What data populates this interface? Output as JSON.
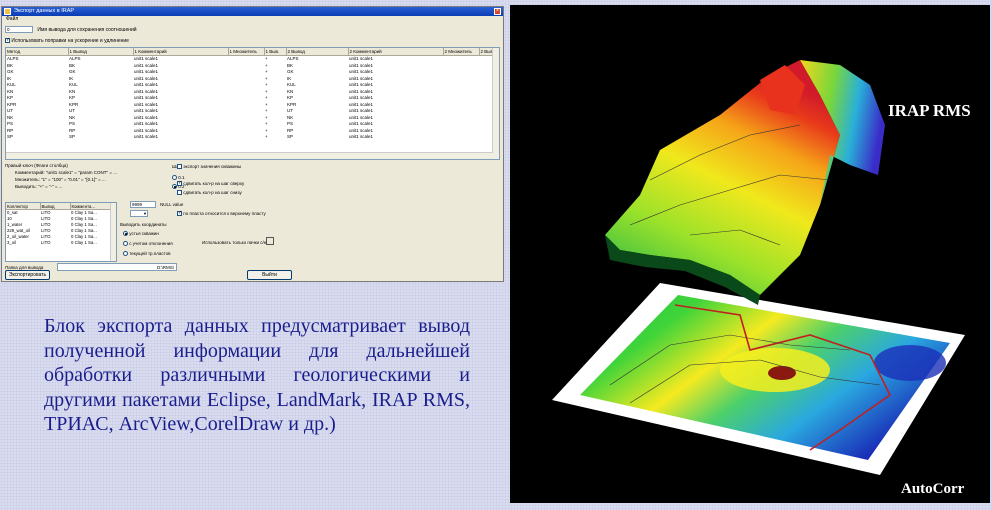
{
  "dialog": {
    "title": "Экспорт данных в IRAP",
    "menu": "Файл",
    "file_value": "0",
    "file_hint": "Имя вывода для сохранения соотношений",
    "use_corrections": "Использовать поправки на ускорение и удлинение",
    "grid": {
      "headers": [
        "Метод",
        "1 Вывод",
        "1 Комментарий",
        "1 Множитель",
        "1 Выв.",
        "2 Вывод",
        "2 Комментарий",
        "2 Множитель",
        "2 Выв."
      ],
      "rows": [
        [
          "ALPS",
          "ALPS",
          "unit1 scale1",
          "",
          "+",
          "ALPS",
          "unit1 scale1",
          "",
          ""
        ],
        [
          "BK",
          "BK",
          "unit1 scale1",
          "",
          "+",
          "BK",
          "unit1 scale1",
          "",
          ""
        ],
        [
          "GK",
          "GK",
          "unit1 scale1",
          "",
          "+",
          "GK",
          "unit1 scale1",
          "",
          ""
        ],
        [
          "IK",
          "IK",
          "unit1 scale1",
          "",
          "+",
          "IK",
          "unit1 scale1",
          "",
          ""
        ],
        [
          "KUL",
          "KUL",
          "unit1 scale1",
          "",
          "+",
          "KUL",
          "unit1 scale1",
          "",
          ""
        ],
        [
          "KN",
          "KN",
          "unit1 scale1",
          "",
          "+",
          "KN",
          "unit1 scale1",
          "",
          ""
        ],
        [
          "KP",
          "KP",
          "unit1 scale1",
          "",
          "+",
          "KP",
          "unit1 scale1",
          "",
          ""
        ],
        [
          "KPR",
          "KPR",
          "unit1 scale1",
          "",
          "+",
          "KPR",
          "unit1 scale1",
          "",
          ""
        ],
        [
          "UT",
          "UT",
          "unit1 scale1",
          "",
          "+",
          "UT",
          "unit1 scale1",
          "",
          ""
        ],
        [
          "NK",
          "NK",
          "unit1 scale1",
          "",
          "+",
          "NK",
          "unit1 scale1",
          "",
          ""
        ],
        [
          "PS",
          "PS",
          "unit1 scale1",
          "",
          "+",
          "PS",
          "unit1 scale1",
          "",
          ""
        ],
        [
          "RP",
          "RP",
          "unit1 scale1",
          "",
          "+",
          "RP",
          "unit1 scale1",
          "",
          ""
        ],
        [
          "SP",
          "SP",
          "unit1 scale1",
          "",
          "+",
          "SP",
          "unit1 scale1",
          "",
          ""
        ]
      ]
    },
    "right_key": "Правый ключ (Флаги столбца)",
    "comment_line": "Комментарий: \"unit1 scale1\" = \"param CONT\" = ...",
    "multiplier_line": "Множитель: \"1\" = \"100\" = \"0.01\" = \"[0.1]\" = ...",
    "output_line": "Выводить: \"+\" = \"-\" = ...",
    "collectors": {
      "headers": [
        "Коллектор",
        "Вывод",
        "Коммента..."
      ],
      "rows": [
        [
          "0_sat",
          "LITO",
          "0 Clay 1 Sa..."
        ],
        [
          "10",
          "LITO",
          "0 Clay 1 Sa..."
        ],
        [
          "1_water",
          "LITO",
          "0 Clay 1 Sa..."
        ],
        [
          "229_wat_oil",
          "LITO",
          "0 Clay 1 Sa..."
        ],
        [
          "2_oil_water",
          "LITO",
          "0 Clay 1 Sa..."
        ],
        [
          "3_oil",
          "LITO",
          "0 Clay 1 Sa..."
        ]
      ]
    },
    "step_label": "Шаг",
    "step_options": [
      "0.1",
      "0.2"
    ],
    "null_value": "9999",
    "null_label": "NULL value",
    "coords_label": "Выводить координаты",
    "coords_options": [
      "устья скважин",
      "с учетом отклонения",
      "текущей тр.пластов"
    ],
    "checks": [
      {
        "label": "экспорт значения скважины",
        "on": false
      },
      {
        "label": "сдвигать кол-р на шаг сверху",
        "on": true
      },
      {
        "label": "сдвигать кол-р на шаг снизу",
        "on": false
      },
      {
        "label": "по пласта относится к верхнему пласту",
        "on": true
      }
    ],
    "only_top_label": "Использовать только пачки с/н",
    "path_label": "Папка для вывода",
    "path_value": "D:\\RMS\\",
    "export_button": "Экспортировать",
    "exit_button": "Выйти"
  },
  "caption": "Блок экспорта данных предусматривает вывод полученной информации для дальнейшей обработки различными геологическими и другими пакетами Eclipse, LandMark, IRAP RMS, ТРИАС, ArcView,CorelDraw и др.)",
  "visual": {
    "irap_label": "IRAP RMS",
    "brand_label": "AutoCorr"
  }
}
